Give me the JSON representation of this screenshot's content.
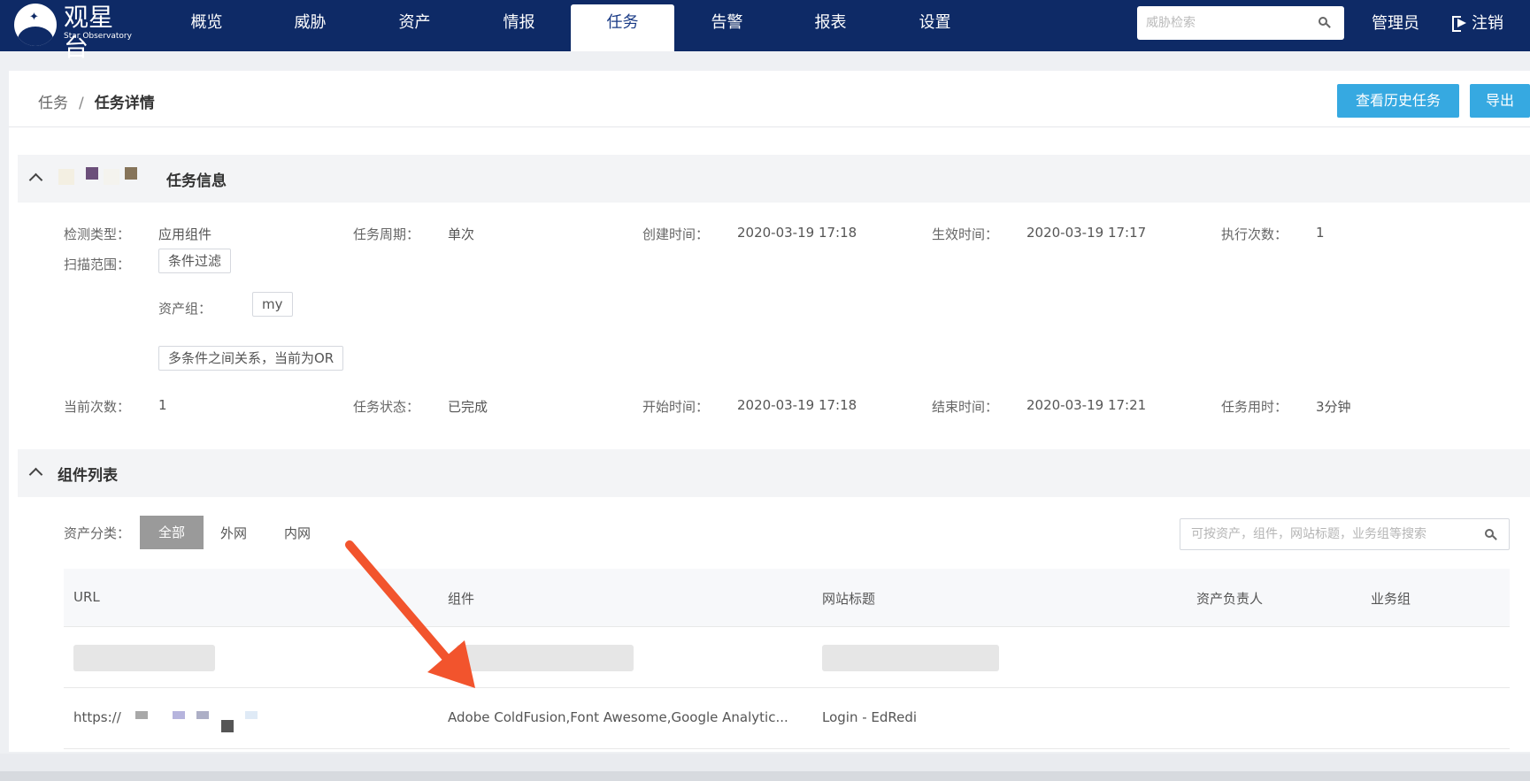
{
  "app": {
    "name": "观星台",
    "subtitle": "Star Observatory"
  },
  "nav": {
    "items": [
      {
        "label": "概览"
      },
      {
        "label": "威胁"
      },
      {
        "label": "资产"
      },
      {
        "label": "情报"
      },
      {
        "label": "任务",
        "active": true
      },
      {
        "label": "告警"
      },
      {
        "label": "报表"
      },
      {
        "label": "设置"
      }
    ],
    "search_placeholder": "威胁检索",
    "user": "管理员",
    "logout": "注销"
  },
  "breadcrumb": {
    "parent": "任务",
    "separator": "/",
    "current": "任务详情"
  },
  "actions": {
    "history": "查看历史任务",
    "export": "导出"
  },
  "task_info": {
    "title": "任务信息",
    "detection_type": {
      "label": "检测类型：",
      "value": "应用组件"
    },
    "period": {
      "label": "任务周期：",
      "value": "单次"
    },
    "created": {
      "label": "创建时间：",
      "value": "2020-03-19 17:18"
    },
    "effective": {
      "label": "生效时间：",
      "value": "2020-03-19 17:17"
    },
    "exec_count": {
      "label": "执行次数：",
      "value": "1"
    },
    "scope": {
      "label": "扫描范围：",
      "filter_tag": "条件过滤",
      "asset_group_label": "资产组：",
      "asset_group_value": "my",
      "relation_tag": "多条件之间关系，当前为OR"
    },
    "current_count": {
      "label": "当前次数：",
      "value": "1"
    },
    "status": {
      "label": "任务状态：",
      "value": "已完成"
    },
    "start": {
      "label": "开始时间：",
      "value": "2020-03-19 17:18"
    },
    "end": {
      "label": "结束时间：",
      "value": "2020-03-19 17:21"
    },
    "duration": {
      "label": "任务用时：",
      "value": "3分钟"
    }
  },
  "components": {
    "title": "组件列表",
    "filter_label": "资产分类：",
    "filters": [
      "全部",
      "外网",
      "内网"
    ],
    "search_placeholder": "可按资产，组件，网站标题，业务组等搜索",
    "columns": [
      "URL",
      "组件",
      "网站标题",
      "资产负责人",
      "业务组"
    ],
    "rows": [
      {
        "url": "",
        "component": "",
        "title": "",
        "owner": "",
        "group": ""
      },
      {
        "url": "https://",
        "component": "Adobe ColdFusion,Font Awesome,Google Analytic...",
        "title": "Login - EdRedi",
        "owner": "",
        "group": ""
      }
    ]
  },
  "colors": {
    "nav_bg": "#0e2a66",
    "accent": "#36a9e1",
    "arrow": "#f2542d"
  }
}
